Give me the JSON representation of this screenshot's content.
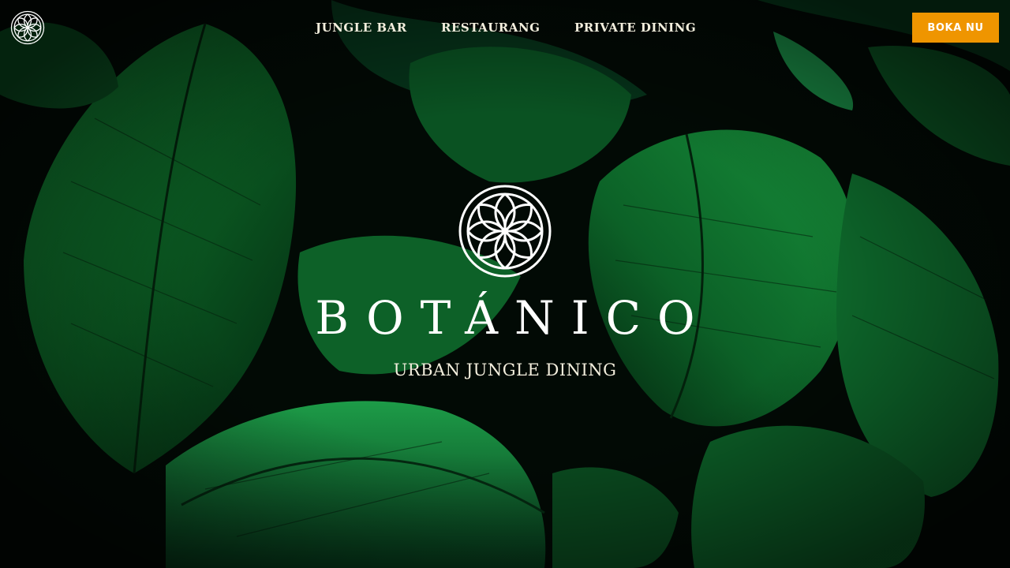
{
  "header": {
    "logo_icon": "rosette-logo-icon",
    "nav": [
      {
        "label": "JUNGLE BAR"
      },
      {
        "label": "RESTAURANG"
      },
      {
        "label": "PRIVATE DINING"
      }
    ],
    "cta_label": "BOKA NU"
  },
  "hero": {
    "background": "tropical-leaves-photo",
    "logo_icon": "rosette-logo-icon",
    "brand_name": "BOTÁNICO",
    "tagline": "URBAN JUNGLE DINING"
  },
  "colors": {
    "accent": "#ef9500",
    "text": "#f3eedd",
    "leaf_green": "#0d5a23",
    "background": "#020a05"
  }
}
